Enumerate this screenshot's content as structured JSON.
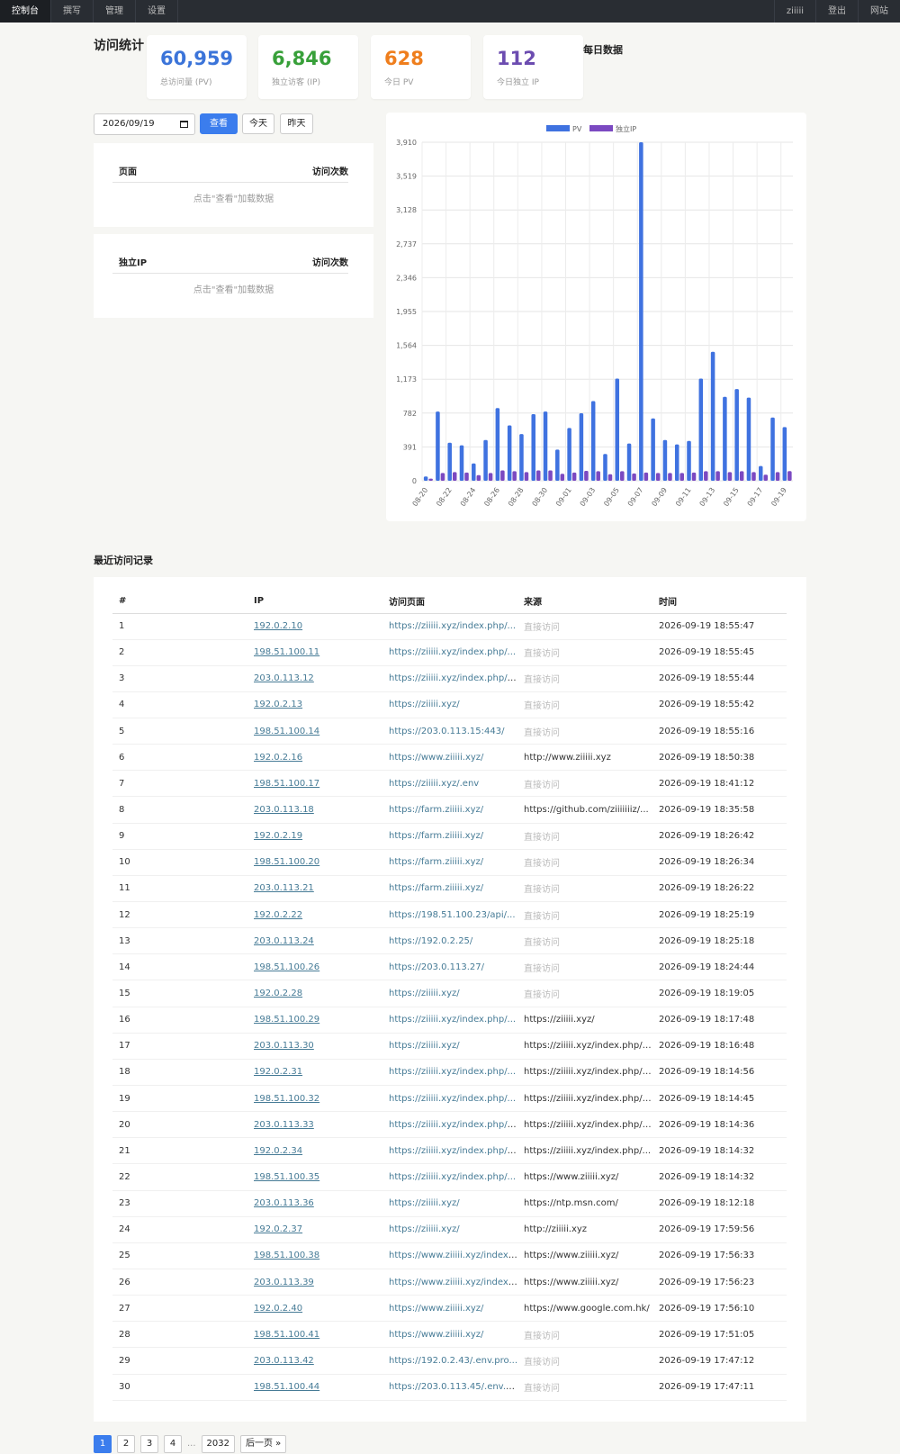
{
  "nav": {
    "left": [
      "控制台",
      "撰写",
      "管理",
      "设置"
    ],
    "right": [
      "ziiiii",
      "登出",
      "网站"
    ]
  },
  "page_title": "访问统计",
  "chart_section_title": "每日数据",
  "stats": [
    {
      "value": "60,959",
      "label": "总访问量 (PV)",
      "color": "#3b74d9"
    },
    {
      "value": "6,846",
      "label": "独立访客 (IP)",
      "color": "#38a03a"
    },
    {
      "value": "628",
      "label": "今日 PV",
      "color": "#ef7e1d"
    },
    {
      "value": "112",
      "label": "今日独立 IP",
      "color": "#6c4cb0"
    }
  ],
  "date_filter": {
    "value": "2026/09/19",
    "query_label": "查看",
    "today_label": "今天",
    "yesterday_label": "昨天"
  },
  "pages_panel": {
    "col1": "页面",
    "col2": "访问次数",
    "empty": "点击\"查看\"加载数据"
  },
  "ip_panel": {
    "col1": "独立IP",
    "col2": "访问次数",
    "empty": "点击\"查看\"加载数据"
  },
  "chart_data": {
    "type": "bar",
    "categories": [
      "08-20",
      "08-21",
      "08-22",
      "08-23",
      "08-24",
      "08-25",
      "08-26",
      "08-27",
      "08-28",
      "08-29",
      "08-30",
      "08-31",
      "09-01",
      "09-02",
      "09-03",
      "09-04",
      "09-05",
      "09-06",
      "09-07",
      "09-08",
      "09-09",
      "09-10",
      "09-11",
      "09-12",
      "09-13",
      "09-14",
      "09-15",
      "09-16",
      "09-17",
      "09-18",
      "09-19"
    ],
    "tick_labels": [
      "08-20",
      "08-22",
      "08-24",
      "08-26",
      "08-28",
      "08-30",
      "09-01",
      "09-03",
      "09-05",
      "09-07",
      "09-09",
      "09-11",
      "09-13",
      "09-15",
      "09-17",
      "09-19"
    ],
    "yticks": [
      0,
      391,
      782,
      1173,
      1564,
      1955,
      2346,
      2737,
      3128,
      3519,
      3910
    ],
    "ytick_labels": [
      "0",
      "391",
      "782",
      "1,173",
      "1,564",
      "1,955",
      "2,346",
      "2,737",
      "3,128",
      "3,519",
      "3,910"
    ],
    "ylim": [
      0,
      3910
    ],
    "legend_position": "top",
    "series": [
      {
        "name": "PV",
        "color": "#3f72e0",
        "values": [
          50,
          800,
          440,
          410,
          200,
          470,
          840,
          640,
          540,
          770,
          800,
          360,
          610,
          780,
          920,
          310,
          1180,
          430,
          3910,
          720,
          470,
          420,
          460,
          1180,
          1490,
          970,
          1060,
          960,
          170,
          730,
          620
        ]
      },
      {
        "name": "独立IP",
        "color": "#7b49c1",
        "values": [
          25,
          90,
          100,
          95,
          65,
          90,
          120,
          110,
          100,
          120,
          120,
          80,
          95,
          115,
          110,
          75,
          110,
          85,
          95,
          90,
          90,
          90,
          95,
          110,
          110,
          100,
          110,
          100,
          70,
          100,
          112
        ]
      }
    ]
  },
  "recent_title": "最近访问记录",
  "table": {
    "headers": [
      "#",
      "IP",
      "访问页面",
      "来源",
      "时间"
    ],
    "rows": [
      [
        "1",
        "192.0.2.10",
        "https://ziiiii.xyz/index.php/...",
        "直接访问",
        "2026-09-19 18:55:47"
      ],
      [
        "2",
        "198.51.100.11",
        "https://ziiiii.xyz/index.php/...",
        "直接访问",
        "2026-09-19 18:55:45"
      ],
      [
        "3",
        "203.0.113.12",
        "https://ziiiii.xyz/index.php/l...",
        "直接访问",
        "2026-09-19 18:55:44"
      ],
      [
        "4",
        "192.0.2.13",
        "https://ziiiii.xyz/",
        "直接访问",
        "2026-09-19 18:55:42"
      ],
      [
        "5",
        "198.51.100.14",
        "https://203.0.113.15:443/",
        "直接访问",
        "2026-09-19 18:55:16"
      ],
      [
        "6",
        "192.0.2.16",
        "https://www.ziiiii.xyz/",
        "http://www.ziiiii.xyz",
        "2026-09-19 18:50:38"
      ],
      [
        "7",
        "198.51.100.17",
        "https://ziiiii.xyz/.env",
        "直接访问",
        "2026-09-19 18:41:12"
      ],
      [
        "8",
        "203.0.113.18",
        "https://farm.ziiiii.xyz/",
        "https://github.com/ziiiiiiiz/...",
        "2026-09-19 18:35:58"
      ],
      [
        "9",
        "192.0.2.19",
        "https://farm.ziiiii.xyz/",
        "直接访问",
        "2026-09-19 18:26:42"
      ],
      [
        "10",
        "198.51.100.20",
        "https://farm.ziiiii.xyz/",
        "直接访问",
        "2026-09-19 18:26:34"
      ],
      [
        "11",
        "203.0.113.21",
        "https://farm.ziiiii.xyz/",
        "直接访问",
        "2026-09-19 18:26:22"
      ],
      [
        "12",
        "192.0.2.22",
        "https://198.51.100.23/api/...",
        "直接访问",
        "2026-09-19 18:25:19"
      ],
      [
        "13",
        "203.0.113.24",
        "https://192.0.2.25/",
        "直接访问",
        "2026-09-19 18:25:18"
      ],
      [
        "14",
        "198.51.100.26",
        "https://203.0.113.27/",
        "直接访问",
        "2026-09-19 18:24:44"
      ],
      [
        "15",
        "192.0.2.28",
        "https://ziiiii.xyz/",
        "直接访问",
        "2026-09-19 18:19:05"
      ],
      [
        "16",
        "198.51.100.29",
        "https://ziiiii.xyz/index.php/...",
        "https://ziiiii.xyz/",
        "2026-09-19 18:17:48"
      ],
      [
        "17",
        "203.0.113.30",
        "https://ziiiii.xyz/",
        "https://ziiiii.xyz/index.php/l...",
        "2026-09-19 18:16:48"
      ],
      [
        "18",
        "192.0.2.31",
        "https://ziiiii.xyz/index.php/...",
        "https://ziiiii.xyz/index.php/l...",
        "2026-09-19 18:14:56"
      ],
      [
        "19",
        "198.51.100.32",
        "https://ziiiii.xyz/index.php/...",
        "https://ziiiii.xyz/index.php/l...",
        "2026-09-19 18:14:45"
      ],
      [
        "20",
        "203.0.113.33",
        "https://ziiiii.xyz/index.php/l...",
        "https://ziiiii.xyz/index.php/l...",
        "2026-09-19 18:14:36"
      ],
      [
        "21",
        "192.0.2.34",
        "https://ziiiii.xyz/index.php/l...",
        "https://ziiiii.xyz/index.php/...",
        "2026-09-19 18:14:32"
      ],
      [
        "22",
        "198.51.100.35",
        "https://ziiiii.xyz/index.php/...",
        "https://www.ziiiii.xyz/",
        "2026-09-19 18:14:32"
      ],
      [
        "23",
        "203.0.113.36",
        "https://ziiiii.xyz/",
        "https://ntp.msn.com/",
        "2026-09-19 18:12:18"
      ],
      [
        "24",
        "192.0.2.37",
        "https://ziiiii.xyz/",
        "http://ziiiii.xyz",
        "2026-09-19 17:59:56"
      ],
      [
        "25",
        "198.51.100.38",
        "https://www.ziiiii.xyz/index....",
        "https://www.ziiiii.xyz/",
        "2026-09-19 17:56:33"
      ],
      [
        "26",
        "203.0.113.39",
        "https://www.ziiiii.xyz/index....",
        "https://www.ziiiii.xyz/",
        "2026-09-19 17:56:23"
      ],
      [
        "27",
        "192.0.2.40",
        "https://www.ziiiii.xyz/",
        "https://www.google.com.hk/",
        "2026-09-19 17:56:10"
      ],
      [
        "28",
        "198.51.100.41",
        "https://www.ziiiii.xyz/",
        "直接访问",
        "2026-09-19 17:51:05"
      ],
      [
        "29",
        "203.0.113.42",
        "https://192.0.2.43/.env.pro...",
        "直接访问",
        "2026-09-19 17:47:12"
      ],
      [
        "30",
        "198.51.100.44",
        "https://203.0.113.45/.env.d...",
        "直接访问",
        "2026-09-19 17:47:11"
      ]
    ]
  },
  "pagination": {
    "pages": [
      "1",
      "2",
      "3",
      "4"
    ],
    "ellipsis": "...",
    "last": "2032",
    "next": "后一页 »",
    "current": "1"
  }
}
